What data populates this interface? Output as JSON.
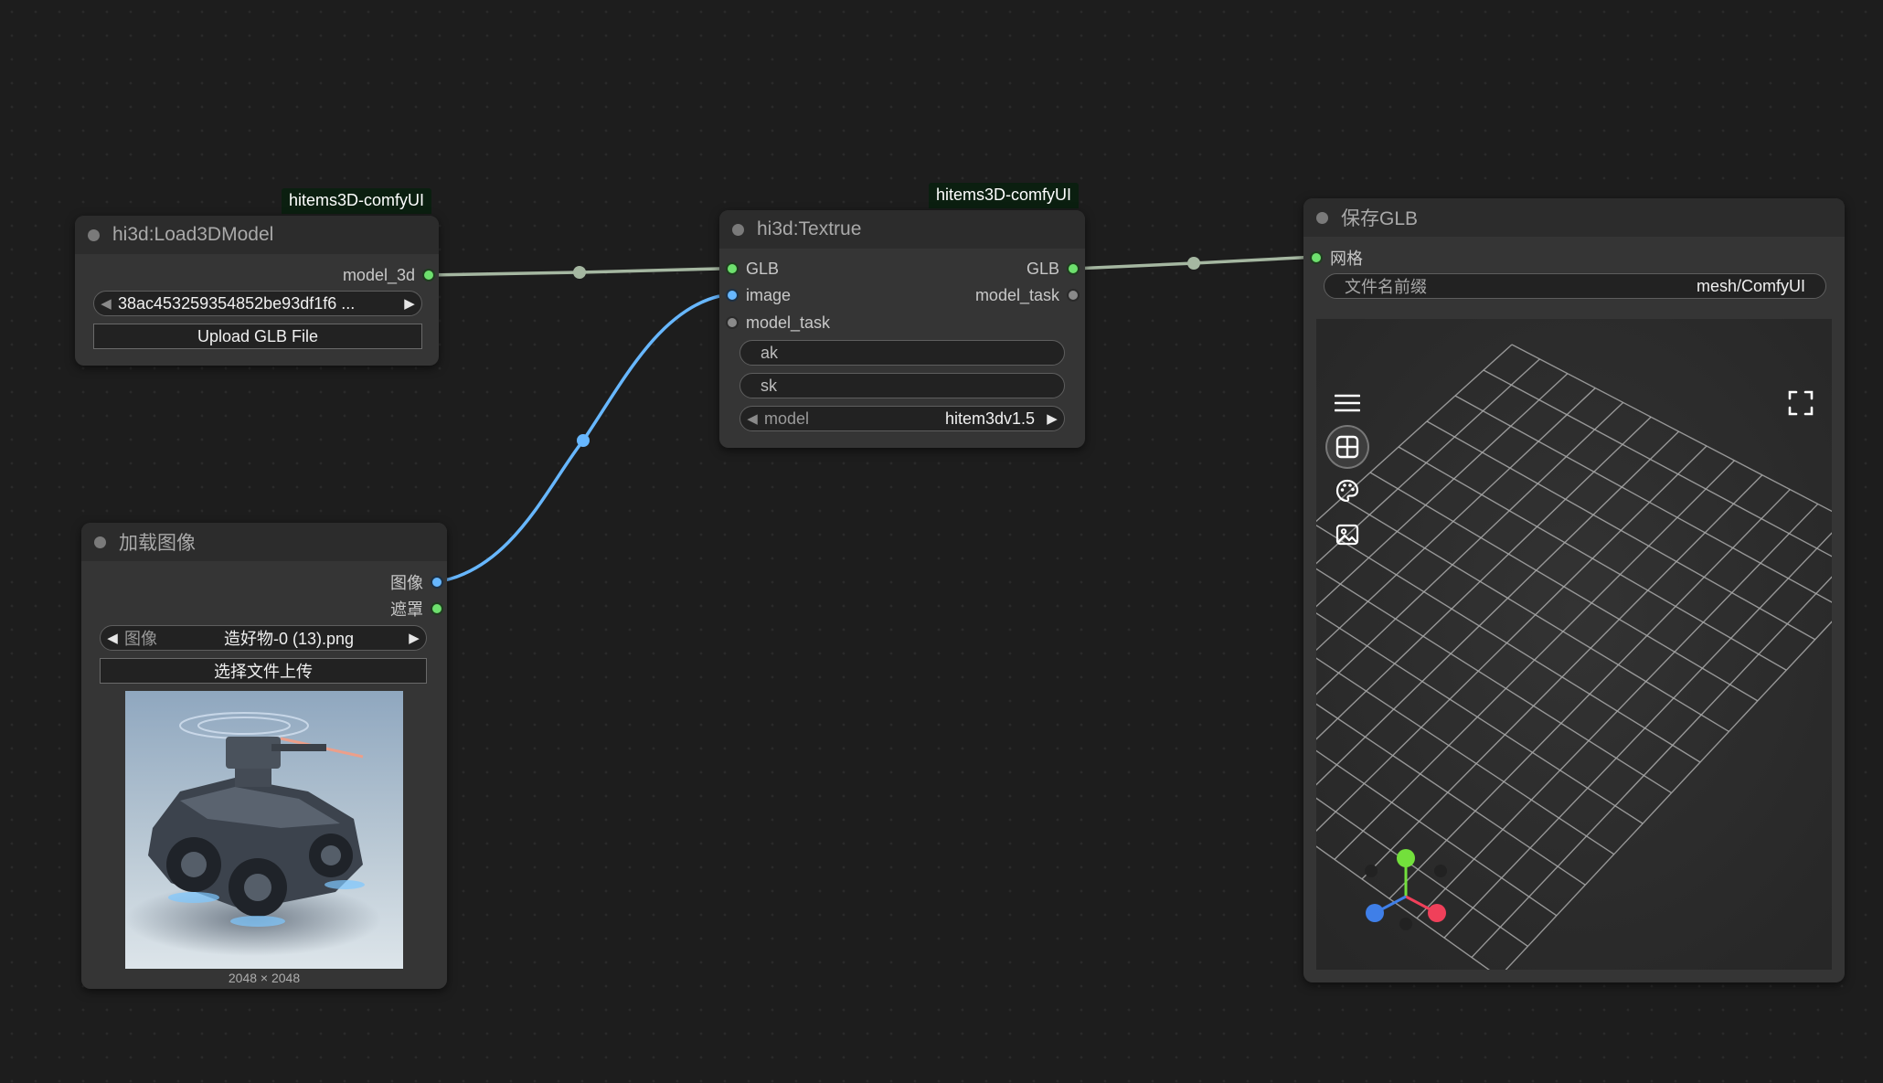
{
  "nodes": {
    "load3d": {
      "badge": "hitems3D-comfyUI",
      "title": "hi3d:Load3DModel",
      "output_label": "model_3d",
      "file_value": "38ac453259354852be93df1f6 ...",
      "upload_label": "Upload GLB File"
    },
    "load_image": {
      "title": "加载图像",
      "output_image": "图像",
      "output_mask": "遮罩",
      "image_label": "图像",
      "image_value": "造好物-0 (13).png",
      "upload_label": "选择文件上传",
      "image_size": "2048 × 2048"
    },
    "texture": {
      "badge": "hitems3D-comfyUI",
      "title": "hi3d:Textrue",
      "inputs": [
        "GLB",
        "image",
        "model_task"
      ],
      "outputs": [
        "GLB",
        "model_task"
      ],
      "ak_placeholder": "ak",
      "sk_placeholder": "sk",
      "model_label": "model",
      "model_value": "hitem3dv1.5"
    },
    "save_glb": {
      "title": "保存GLB",
      "input_label": "网格",
      "prefix_label": "文件名前缀",
      "prefix_value": "mesh/ComfyUI"
    }
  },
  "viewer": {
    "toolbar_icons": [
      "menu-icon",
      "grid-view-icon",
      "palette-icon",
      "image-icon"
    ],
    "active_tool": "grid-view-icon",
    "axis_colors": {
      "x": "#f0405a",
      "y": "#73e03c",
      "z": "#3f7fe8"
    }
  },
  "colors": {
    "link_mesh": "#a5b7a1",
    "link_image": "#67b7ff",
    "badge_bg": "#0b1f10"
  }
}
